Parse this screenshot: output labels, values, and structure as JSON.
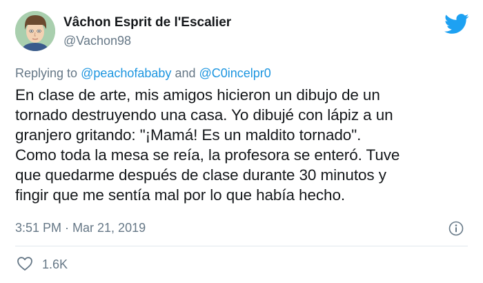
{
  "author": {
    "display_name": "Vâchon Esprit de l'Escalier",
    "handle": "@Vachon98"
  },
  "reply": {
    "prefix": "Replying to ",
    "mention_1": "@peachofababy",
    "connector": " and ",
    "mention_2": "@C0incelpr0"
  },
  "tweet": {
    "text": "En clase de arte, mis amigos hicieron un dibujo de un\ntornado destruyendo una casa. Yo dibujé con lápiz a un\ngranjero gritando: \"¡Mamá! Es un maldito tornado\".\nComo toda la mesa se reía, la profesora se enteró. Tuve\nque quedarme después de clase durante 30 minutos y\nfingir que me sentía mal por lo que había hecho.",
    "timestamp": "3:51 PM · Mar 21, 2019",
    "likes": "1.6K"
  },
  "colors": {
    "brand": "#1da1f2",
    "mention": "#1b95e0",
    "secondary_text": "#657786",
    "primary_text": "#14171a",
    "divider": "#e1e8ed"
  },
  "icons": {
    "logo": "twitter-bird-icon",
    "info": "info-icon",
    "like": "heart-icon"
  }
}
